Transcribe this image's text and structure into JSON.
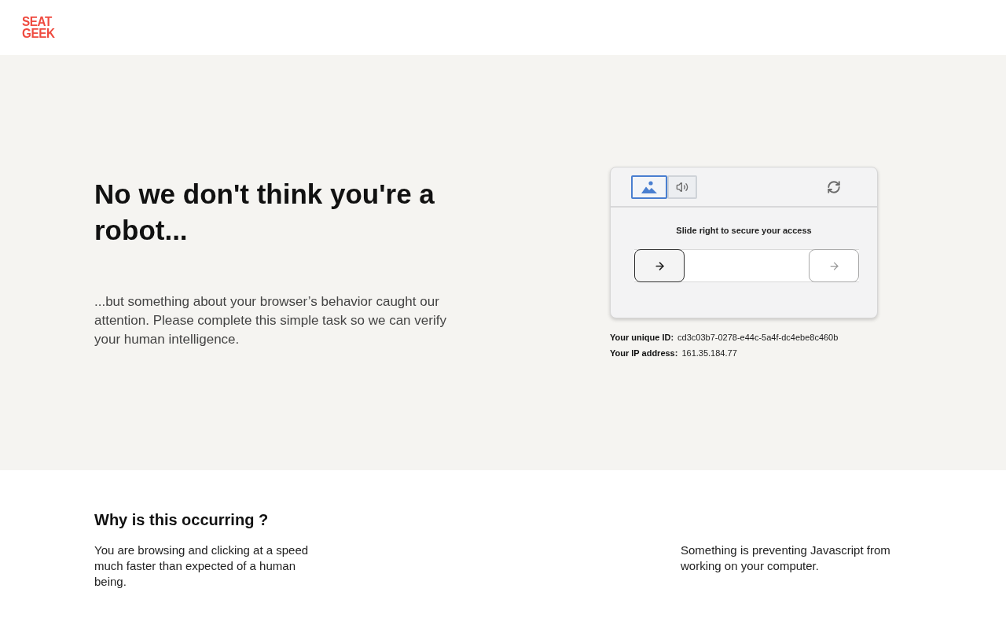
{
  "header": {
    "logo": [
      "SEAT",
      "GEEK"
    ]
  },
  "hero": {
    "title": "No we don't think you're a robot...",
    "text": "...but something about your browser’s behavior caught our attention. Please complete this simple task so we can verify your human intelligence."
  },
  "captcha": {
    "tabs": [
      {
        "kind": "image",
        "selected": true
      },
      {
        "kind": "audio",
        "selected": false
      }
    ],
    "instruction": "Slide right to secure your access",
    "slider": {
      "level": 0
    }
  },
  "info": [
    {
      "label": "Your unique ID:",
      "value": "cd3c03b7-0278-e44c-5a4f-dc4ebe8c460b"
    },
    {
      "label": "Your IP address:",
      "value": "161.35.184.77"
    }
  ],
  "footer": {
    "title": "Why is this occurring ?",
    "reasons": [
      "You are browsing and clicking at a speed much faster than expected of a human being.",
      "Something is preventing Javascript from working on your computer."
    ]
  }
}
